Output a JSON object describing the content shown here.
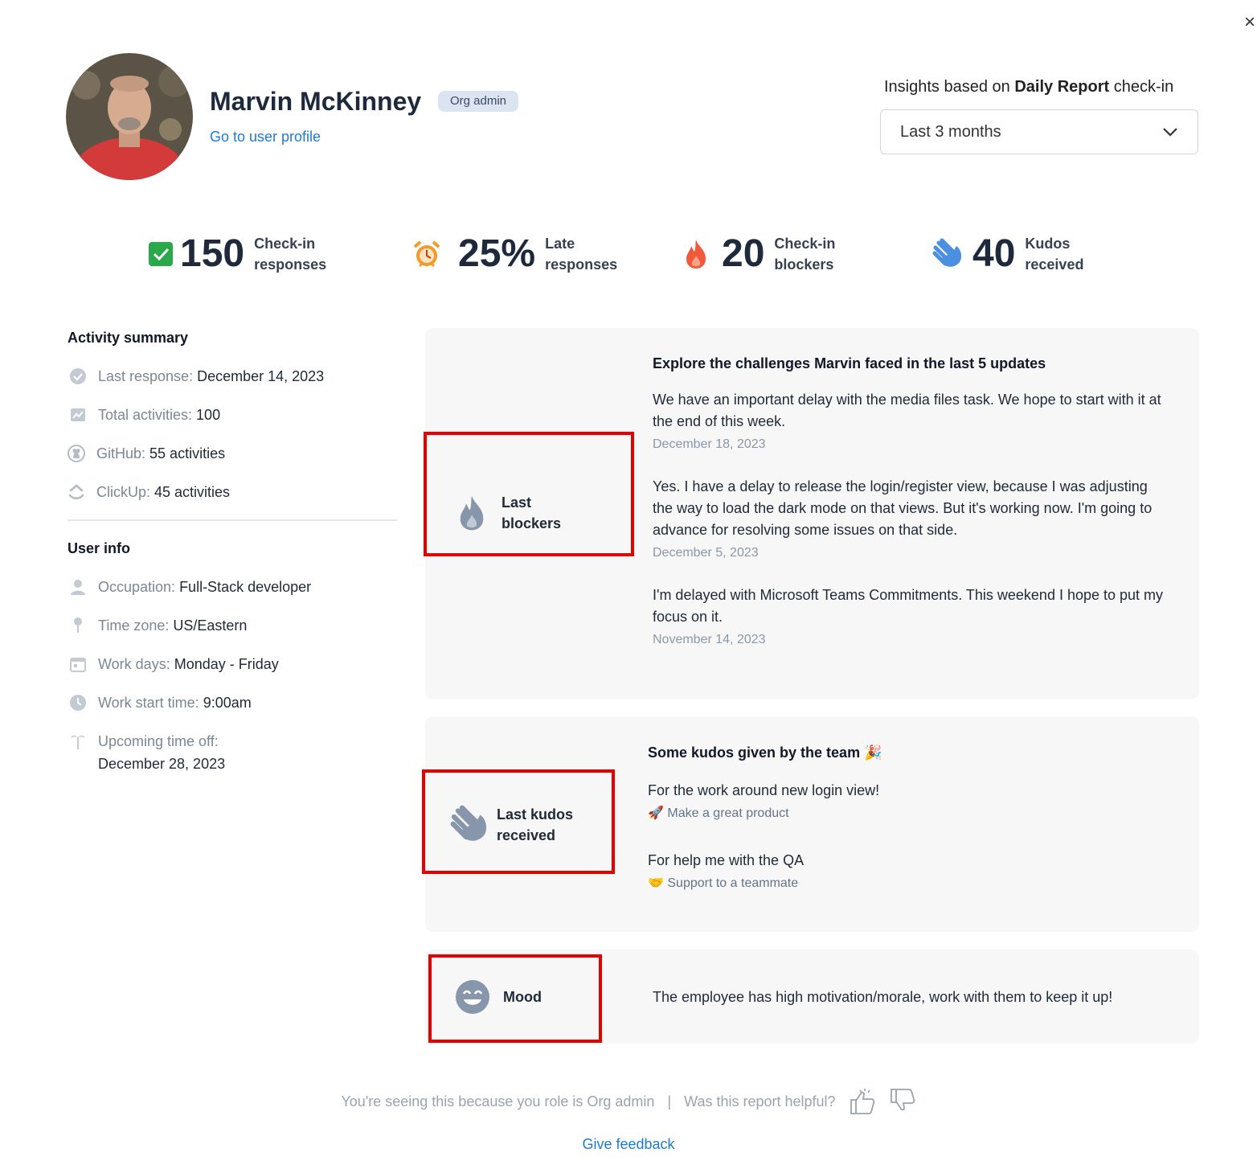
{
  "header": {
    "name": "Marvin McKinney",
    "role_badge": "Org admin",
    "profile_link": "Go to user profile",
    "insights_prefix": "Insights based on ",
    "insights_report": "Daily Report",
    "insights_suffix": " check-in",
    "period_select": "Last 3 months"
  },
  "stats": [
    {
      "value": "150",
      "label_line1": "Check-in",
      "label_line2": "responses",
      "icon": "check-square-icon"
    },
    {
      "value": "25%",
      "label_line1": "Late",
      "label_line2": "responses",
      "icon": "alarm-clock-icon"
    },
    {
      "value": "20",
      "label_line1": "Check-in",
      "label_line2": "blockers",
      "icon": "fire-icon"
    },
    {
      "value": "40",
      "label_line1": "Kudos",
      "label_line2": "received",
      "icon": "clapping-hand-icon"
    }
  ],
  "activity": {
    "title": "Activity summary",
    "rows": [
      {
        "key": "Last response: ",
        "value": "December 14, 2023",
        "icon": "check-circle-icon"
      },
      {
        "key": "Total activities: ",
        "value": "100",
        "icon": "chart-icon"
      },
      {
        "key": "GitHub: ",
        "value": "55 activities",
        "icon": "github-icon"
      },
      {
        "key": "ClickUp: ",
        "value": "45 activities",
        "icon": "clickup-icon"
      }
    ]
  },
  "user_info": {
    "title": "User info",
    "rows": [
      {
        "key": "Occupation: ",
        "value": "Full-Stack developer",
        "icon": "user-icon"
      },
      {
        "key": "Time zone: ",
        "value": "US/Eastern",
        "icon": "pin-icon"
      },
      {
        "key": "Work days: ",
        "value": "Monday - Friday",
        "icon": "calendar-icon"
      },
      {
        "key": "Work start time: ",
        "value": "9:00am",
        "icon": "clock-icon"
      },
      {
        "key": "Upcoming time off:",
        "value": "December 28, 2023",
        "icon": "palm-tree-icon"
      }
    ]
  },
  "blockers": {
    "label": "Last blockers",
    "label_line1": "Last",
    "label_line2": "blockers",
    "title": "Explore the challenges Marvin faced in the last 5 updates",
    "entries": [
      {
        "text": "We have an important delay with the media files task. We hope to start with it at the end of this week.",
        "date": "December 18, 2023"
      },
      {
        "text": "Yes. I have a delay to release the login/register view, because I was adjusting the way to load the dark mode on that views. But it's working now. I'm going to advance for resolving some issues on that side.",
        "date": "December 5, 2023"
      },
      {
        "text": "I'm delayed with Microsoft Teams Commitments. This weekend I hope to put my focus on it.",
        "date": "November 14, 2023"
      }
    ]
  },
  "kudos": {
    "label_line1": "Last kudos",
    "label_line2": "received",
    "title": "Some kudos given by the team",
    "title_emoji": "🎉",
    "entries": [
      {
        "text": "For the work around new login view!",
        "tag_emoji": "🚀",
        "tag": "Make a great product"
      },
      {
        "text": "For help me with the QA",
        "tag_emoji": "🤝",
        "tag": "Support to a teammate"
      }
    ]
  },
  "mood": {
    "label": "Mood",
    "text": "The employee has high motivation/morale, work with them to keep it up!"
  },
  "footer": {
    "notice": "You're seeing this because you role is Org admin",
    "separator": "|",
    "question": "Was this report helpful?",
    "feedback": "Give feedback"
  },
  "close_glyph": "×"
}
